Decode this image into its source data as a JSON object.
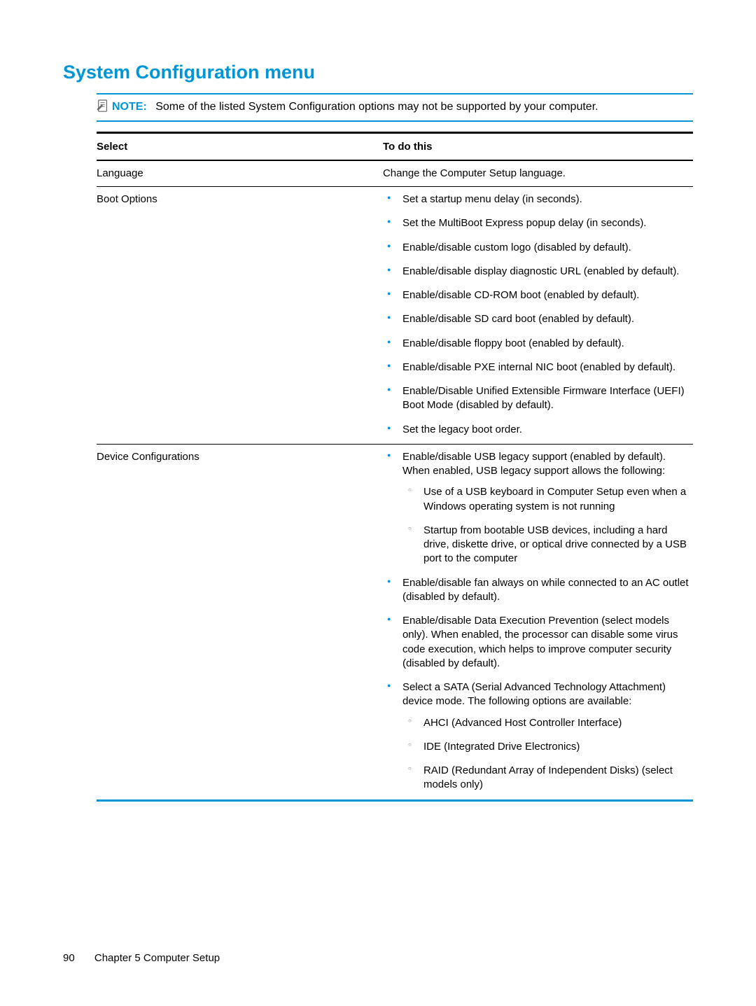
{
  "title": "System Configuration menu",
  "note": {
    "label": "NOTE:",
    "text": "Some of the listed System Configuration options may not be supported by your computer."
  },
  "table": {
    "headers": {
      "select": "Select",
      "todo": "To do this"
    },
    "rows": [
      {
        "select": "Language",
        "todo_plain": "Change the Computer Setup language."
      },
      {
        "select": "Boot Options",
        "bullets": [
          {
            "text": "Set a startup menu delay (in seconds)."
          },
          {
            "text": "Set the MultiBoot Express popup delay (in seconds)."
          },
          {
            "text": "Enable/disable custom logo (disabled by default)."
          },
          {
            "text": "Enable/disable display diagnostic URL (enabled by default)."
          },
          {
            "text": "Enable/disable CD-ROM boot (enabled by default)."
          },
          {
            "text": "Enable/disable SD card boot (enabled by default)."
          },
          {
            "text": "Enable/disable floppy boot (enabled by default)."
          },
          {
            "text": "Enable/disable PXE internal NIC boot (enabled by default)."
          },
          {
            "text": "Enable/Disable Unified Extensible Firmware Interface (UEFI) Boot Mode (disabled by default)."
          },
          {
            "text": "Set the legacy boot order."
          }
        ]
      },
      {
        "select": "Device Configurations",
        "bullets": [
          {
            "text": "Enable/disable USB legacy support (enabled by default). When enabled, USB legacy support allows the following:",
            "sub": [
              "Use of a USB keyboard in Computer Setup even when a Windows operating system is not running",
              "Startup from bootable USB devices, including a hard drive, diskette drive, or optical drive connected by a USB port to the computer"
            ]
          },
          {
            "text": "Enable/disable fan always on while connected to an AC outlet (disabled by default)."
          },
          {
            "text": "Enable/disable Data Execution Prevention (select models only). When enabled, the processor can disable some virus code execution, which helps to improve computer security (disabled by default)."
          },
          {
            "text": "Select a SATA (Serial Advanced Technology Attachment) device mode. The following options are available:",
            "sub": [
              "AHCI (Advanced Host Controller Interface)",
              "IDE (Integrated Drive Electronics)",
              "RAID (Redundant Array of Independent Disks) (select models only)"
            ]
          }
        ]
      }
    ]
  },
  "footer": {
    "page": "90",
    "chapter": "Chapter 5   Computer Setup"
  }
}
